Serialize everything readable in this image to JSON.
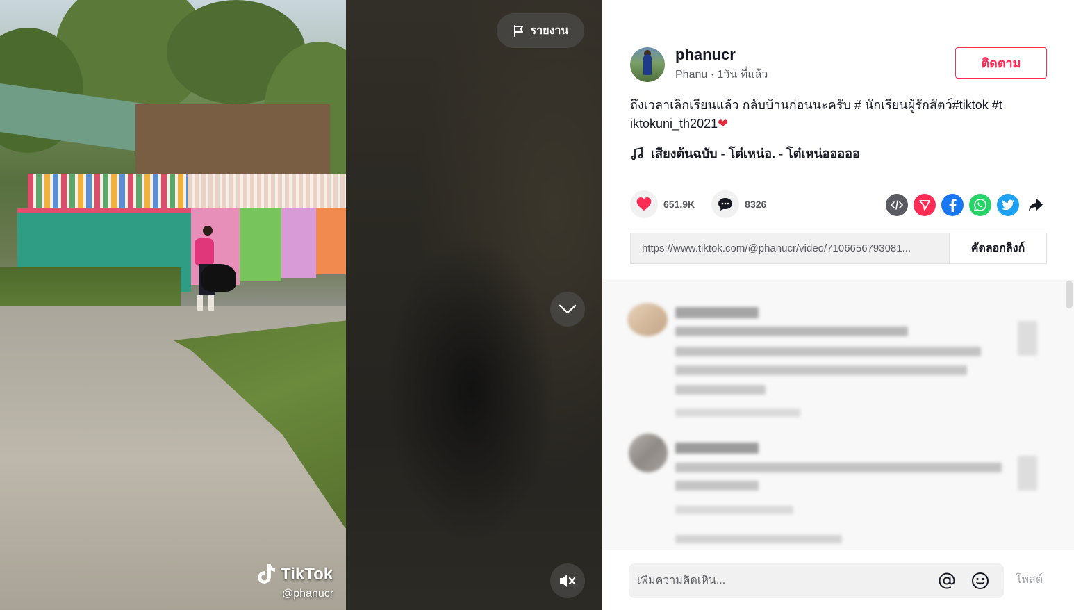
{
  "video": {
    "report_label": "รายงาน",
    "watermark_brand": "TikTok",
    "watermark_handle": "@phanucr",
    "icons": {
      "report": "flag-icon",
      "next": "chevron-down-icon",
      "mute": "speaker-muted-icon"
    }
  },
  "author": {
    "username": "phanucr",
    "nickname": "Phanu",
    "separator": " · ",
    "posted": "1วัน ที่แล้ว",
    "follow_label": "ติดตาม"
  },
  "caption": {
    "text_line1": "ถึงเวลาเลิกเรียนแล้ว กลับบ้านก่อนนะครับ # นักเรียนผู้รักสัตว์#tiktok #t",
    "text_line2": "iktokuni_th2021",
    "emoji": "❤️"
  },
  "music": {
    "label": "เสียงต้นฉบับ - โต๋เหน่อ. - โต๋เหน่อออออ"
  },
  "stats": {
    "likes": "651.9K",
    "comments": "8326"
  },
  "share": {
    "icons": [
      "embed-icon",
      "send-icon",
      "facebook-icon",
      "whatsapp-icon",
      "twitter-icon",
      "share-arrow-icon"
    ],
    "colors": {
      "embed": "#5a5b62",
      "send": "#fe2c55",
      "facebook": "#1877f2",
      "whatsapp": "#25d366",
      "twitter": "#1da1f2"
    }
  },
  "link": {
    "url": "https://www.tiktok.com/@phanucr/video/7106656793081...",
    "copy_label": "คัดลอกลิงก์"
  },
  "comment_input": {
    "placeholder": "เพิ่มความคิดเห็น...",
    "mention_icon": "at-icon",
    "emoji_icon": "emoji-icon",
    "post_label": "โพสต์"
  },
  "theme": {
    "accent": "#fe2c55",
    "heart": "#fe2c55",
    "text": "#161823",
    "muted": "#5a5b62"
  }
}
